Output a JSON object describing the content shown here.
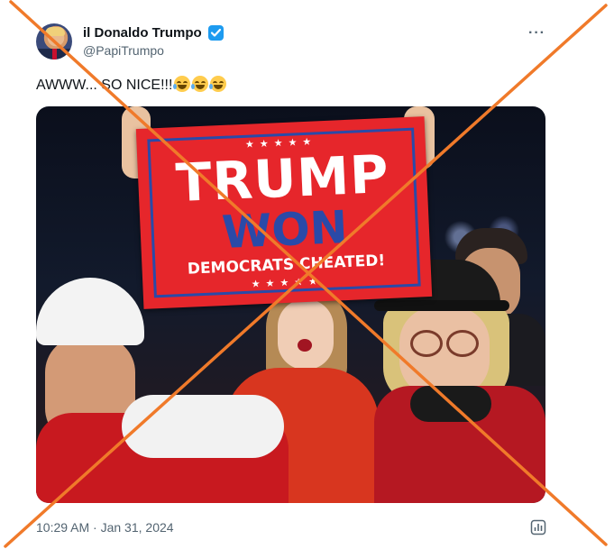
{
  "tweet": {
    "display_name": "il Donaldo Trumpo",
    "handle": "@PapiTrumpo",
    "text": "AWWW... SO NICE!!!",
    "emoji_count": 3,
    "emoji_name": "face-with-tears-of-joy",
    "timestamp": "10:29 AM · Jan 31, 2024",
    "verified": true,
    "more_icon": "more-horizontal-icon",
    "analytics_icon": "analytics-icon"
  },
  "photo": {
    "flag": {
      "line1": "TRUMP",
      "line2": "WON",
      "line3": "DEMOCRATS CHEATED!",
      "stars": "★★★★★"
    }
  },
  "overlay": {
    "type": "cross-out",
    "color": "#f07a2a"
  },
  "colors": {
    "verified": "#1d9bf0",
    "secondary_text": "#536471",
    "flag_red": "#e6262b",
    "flag_blue": "#2a4aa8"
  }
}
